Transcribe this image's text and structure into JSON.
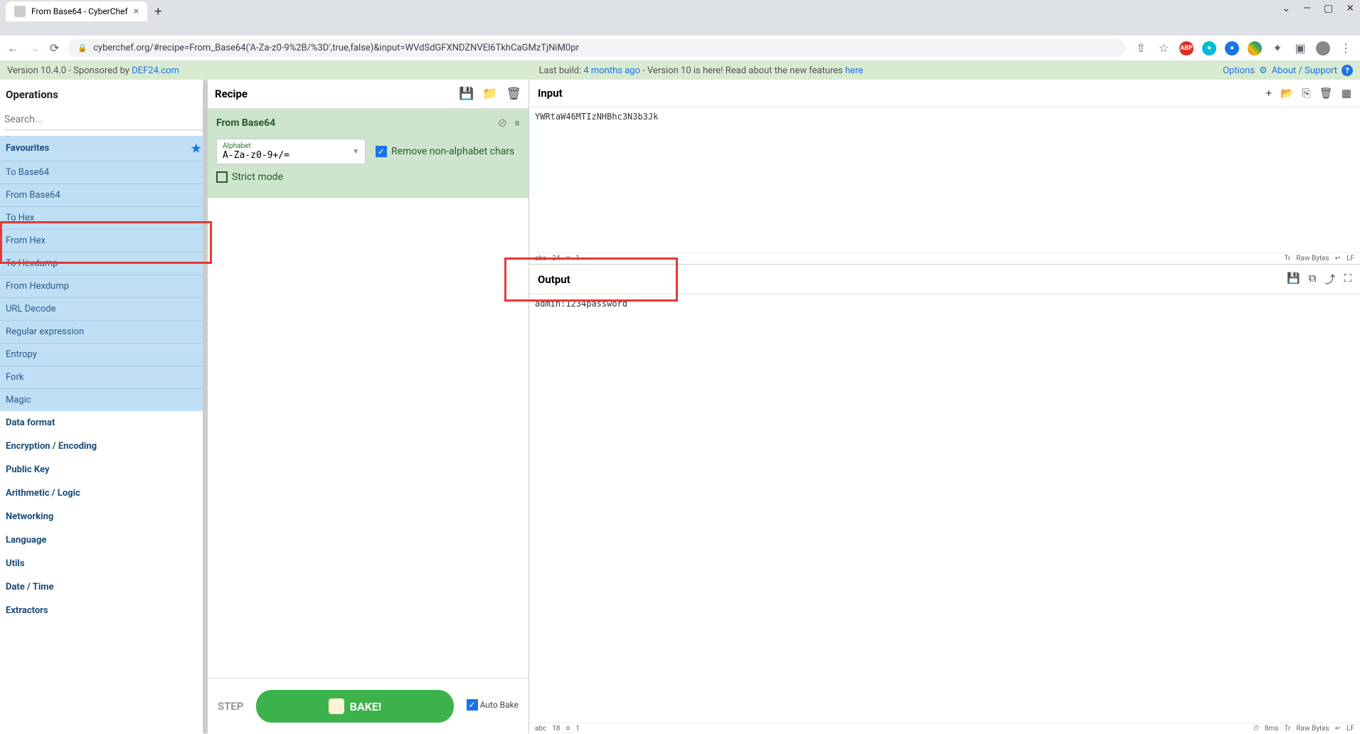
{
  "browser": {
    "tab_title": "From Base64 - CyberChef",
    "url": "cyberchef.org/#recipe=From_Base64('A-Za-z0-9%2B/%3D',true,false)&input=WVdSdGFXNDZNVEl6TkhCaGMzTjNiM0pr"
  },
  "info_bar": {
    "version": "Version 10.4.0 - ",
    "sponsored": "Sponsored by ",
    "sponsor_link": "DEF24.com",
    "center_prefix": "Last build: ",
    "center_link": "4 months ago",
    "center_suffix": " - Version 10 is here! Read about the new features ",
    "center_link2": "here",
    "options": "Options",
    "about": "About / Support"
  },
  "operations": {
    "title": "Operations",
    "search_placeholder": "Search...",
    "favourites": "Favourites",
    "items": [
      "To Base64",
      "From Base64",
      "To Hex",
      "From Hex",
      "To Hexdump",
      "From Hexdump",
      "URL Decode",
      "Regular expression",
      "Entropy",
      "Fork",
      "Magic"
    ],
    "categories": [
      "Data format",
      "Encryption / Encoding",
      "Public Key",
      "Arithmetic / Logic",
      "Networking",
      "Language",
      "Utils",
      "Date / Time",
      "Extractors"
    ]
  },
  "recipe": {
    "title": "Recipe",
    "op_name": "From Base64",
    "alphabet_label": "Alphabet",
    "alphabet_value": "A-Za-z0-9+/=",
    "remove_non_alpha": "Remove non-alphabet chars",
    "strict_mode": "Strict mode",
    "step": "STEP",
    "bake": "BAKE!",
    "auto_bake": "Auto Bake"
  },
  "input": {
    "title": "Input",
    "content": "YWRtaW46MTIzNHBhc3N3b3Jk",
    "status_chars": "24",
    "status_lines": "1",
    "status_raw": "Raw Bytes",
    "status_lf": "LF"
  },
  "output": {
    "title": "Output",
    "content": "admin:1234password",
    "status_chars": "18",
    "status_lines": "1",
    "status_time": "8ms",
    "status_raw": "Raw Bytes",
    "status_lf": "LF"
  }
}
